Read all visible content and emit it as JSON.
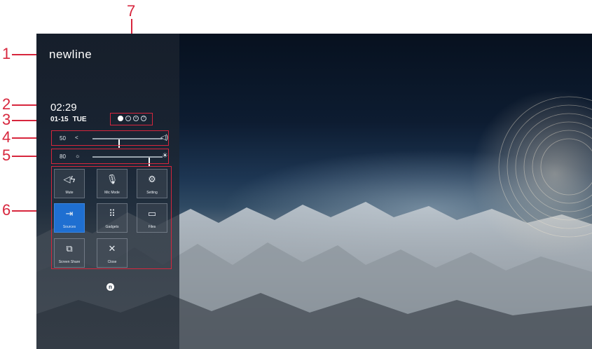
{
  "callouts": [
    "1",
    "2",
    "3",
    "4",
    "5",
    "6",
    "7"
  ],
  "panel": {
    "logo": "newline",
    "time": "02:29",
    "date": "01-15",
    "day": "TUE",
    "status_icons": [
      "record-icon",
      "wifi-icon",
      "network-icon",
      "help-icon"
    ],
    "volume": {
      "value": "50",
      "level": 0.38
    },
    "brightness": {
      "value": "80",
      "level": 0.82
    },
    "tiles": [
      {
        "label": "Mute",
        "icon": "speaker-icon"
      },
      {
        "label": "Mic Mode",
        "icon": "microphone-icon"
      },
      {
        "label": "Setting",
        "icon": "gear-icon"
      },
      {
        "label": "Sources",
        "icon": "input-icon"
      },
      {
        "label": "Gadgets",
        "icon": "grid-icon"
      },
      {
        "label": "Files",
        "icon": "folder-icon"
      },
      {
        "label": "Screen Share",
        "icon": "screen-share-icon"
      },
      {
        "label": "Close",
        "icon": "close-icon"
      }
    ]
  },
  "colors": {
    "annotation": "#d7263d",
    "active_tile": "#1f6fd1"
  }
}
